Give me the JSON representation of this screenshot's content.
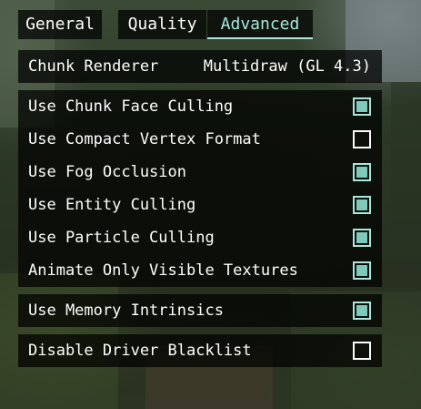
{
  "tabs": [
    {
      "label": "General",
      "active": false
    },
    {
      "label": "Quality",
      "active": false
    },
    {
      "label": "Advanced",
      "active": true
    }
  ],
  "chunk_renderer": {
    "label": "Chunk Renderer",
    "value": "Multidraw (GL 4.3)"
  },
  "options": [
    {
      "label": "Use Chunk Face Culling",
      "checked": true
    },
    {
      "label": "Use Compact Vertex Format",
      "checked": false
    },
    {
      "label": "Use Fog Occlusion",
      "checked": true
    },
    {
      "label": "Use Entity Culling",
      "checked": true
    },
    {
      "label": "Use Particle Culling",
      "checked": true
    },
    {
      "label": "Animate Only Visible Textures",
      "checked": true
    }
  ],
  "memory": {
    "label": "Use Memory Intrinsics",
    "checked": true
  },
  "driver": {
    "label": "Disable Driver Blacklist",
    "checked": false
  },
  "colors": {
    "accent": "#a8e8dc",
    "checkbox_fill": "#7fc9bc",
    "panel": "rgba(0,0,0,0.72)"
  }
}
